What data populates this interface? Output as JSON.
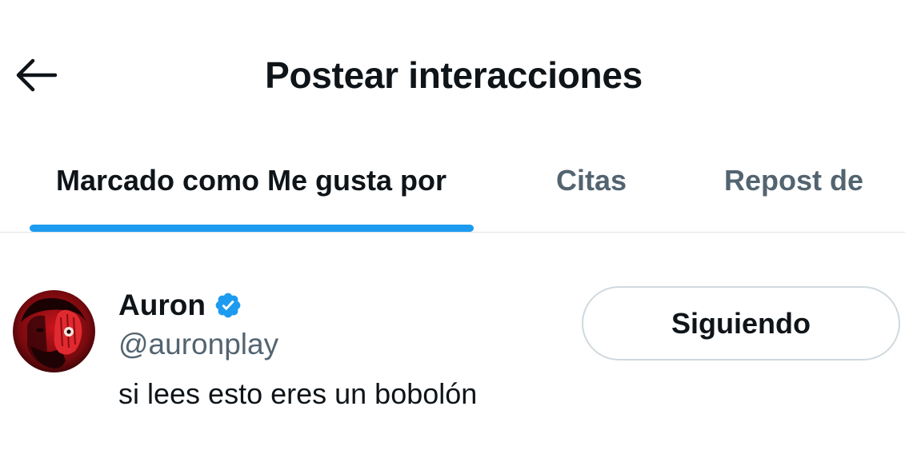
{
  "header": {
    "title": "Postear interacciones",
    "back_icon": "arrow-left-icon"
  },
  "tabs": [
    {
      "label": "Marcado como Me gusta por",
      "active": true
    },
    {
      "label": "Citas",
      "active": false
    },
    {
      "label": "Repost de",
      "active": false
    }
  ],
  "colors": {
    "accent": "#1d9bf0",
    "text_primary": "#0f1419",
    "text_secondary": "#536471",
    "border": "#cfd9de"
  },
  "user": {
    "display_name": "Auron",
    "verified_icon": "verified-badge-icon",
    "handle": "@auronplay",
    "bio": "si lees esto eres un bobolón",
    "follow_button_label": "Siguiendo"
  }
}
